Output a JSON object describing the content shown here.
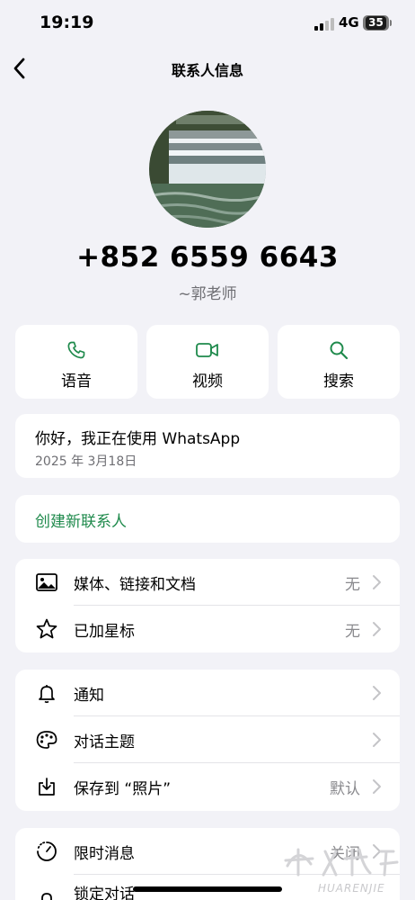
{
  "status_bar": {
    "time": "19:19",
    "network": "4G",
    "battery": "35"
  },
  "nav": {
    "title": "联系人信息",
    "back_icon": "chevron-left-icon"
  },
  "contact": {
    "phone": "+852 6559 6643",
    "alias": "~郭老师"
  },
  "actions": [
    {
      "label": "语音",
      "icon": "phone-icon"
    },
    {
      "label": "视频",
      "icon": "video-icon"
    },
    {
      "label": "搜索",
      "icon": "search-icon"
    }
  ],
  "about": {
    "text": "你好，我正在使用 WhatsApp",
    "date": "2025 年 3月18日"
  },
  "create_contact": {
    "label": "创建新联系人"
  },
  "group1": [
    {
      "label": "媒体、链接和文档",
      "value": "无",
      "icon": "image-icon"
    },
    {
      "label": "已加星标",
      "value": "无",
      "icon": "star-icon"
    }
  ],
  "group2": [
    {
      "label": "通知",
      "value": "",
      "icon": "bell-icon"
    },
    {
      "label": "对话主题",
      "value": "",
      "icon": "palette-icon"
    },
    {
      "label": "保存到 “照片”",
      "value": "默认",
      "icon": "save-download-icon"
    }
  ],
  "group3": [
    {
      "label": "限时消息",
      "value": "关闭",
      "icon": "timer-icon"
    },
    {
      "label": "锁定对话",
      "value": "",
      "icon": "lock-icon"
    }
  ],
  "watermark": {
    "text": "HUARENJIE"
  },
  "colors": {
    "accent": "#1f8a4c",
    "background": "#f2f2f7",
    "card": "#ffffff",
    "secondary_text": "#6e6e73"
  }
}
